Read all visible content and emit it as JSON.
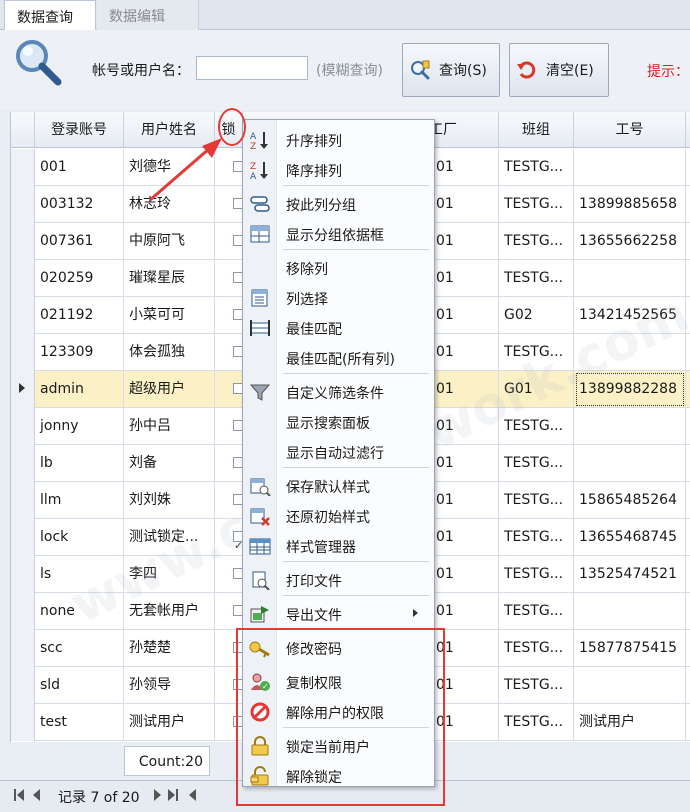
{
  "tabs": [
    {
      "label": "数据查询"
    },
    {
      "label": "数据编辑"
    }
  ],
  "toolbar": {
    "search_label": "帐号或用户名：",
    "search_value": "",
    "fuzzy_label": "(模糊查询)",
    "query_button": "查询(S)",
    "clear_button": "清空(E)",
    "hint_label": "提示："
  },
  "grid": {
    "columns": [
      "登录账号",
      "用户姓名",
      "锁",
      "工厂",
      "班组",
      "工号"
    ],
    "rows": [
      {
        "account": "001",
        "name": "刘德华",
        "locked": false,
        "factory": "01",
        "team": "TESTG...",
        "job_no": ""
      },
      {
        "account": "003132",
        "name": "林志玲",
        "locked": false,
        "factory": "01",
        "team": "TESTG...",
        "job_no": "13899885658"
      },
      {
        "account": "007361",
        "name": "中原阿飞",
        "locked": false,
        "factory": "01",
        "team": "TESTG...",
        "job_no": "13655662258"
      },
      {
        "account": "020259",
        "name": "璀璨星辰",
        "locked": false,
        "factory": "01",
        "team": "TESTG...",
        "job_no": ""
      },
      {
        "account": "021192",
        "name": "小菜可可",
        "locked": false,
        "factory": "01",
        "team": "G02",
        "job_no": "13421452565"
      },
      {
        "account": "123309",
        "name": "体会孤独",
        "locked": false,
        "factory": "01",
        "team": "TESTG...",
        "job_no": ""
      },
      {
        "account": "admin",
        "name": "超级用户",
        "locked": false,
        "factory": "01",
        "team": "G01",
        "job_no": "13899882288"
      },
      {
        "account": "jonny",
        "name": "孙中吕",
        "locked": false,
        "factory": "01",
        "team": "TESTG...",
        "job_no": ""
      },
      {
        "account": "lb",
        "name": "刘备",
        "locked": false,
        "factory": "01",
        "team": "TESTG...",
        "job_no": ""
      },
      {
        "account": "llm",
        "name": "刘刘姝",
        "locked": false,
        "factory": "01",
        "team": "TESTG...",
        "job_no": "15865485264"
      },
      {
        "account": "lock",
        "name": "测试锁定...",
        "locked": true,
        "factory": "01",
        "team": "TESTG...",
        "job_no": "13655468745"
      },
      {
        "account": "ls",
        "name": "李四",
        "locked": false,
        "factory": "01",
        "team": "TESTG...",
        "job_no": "13525474521"
      },
      {
        "account": "none",
        "name": "无套帐用户",
        "locked": false,
        "factory": "01",
        "team": "TESTG...",
        "job_no": ""
      },
      {
        "account": "scc",
        "name": "孙楚楚",
        "locked": false,
        "factory": "01",
        "team": "TESTG...",
        "job_no": "15877875415"
      },
      {
        "account": "sld",
        "name": "孙领导",
        "locked": false,
        "factory": "01",
        "team": "TESTG...",
        "job_no": ""
      },
      {
        "account": "test",
        "name": "测试用户",
        "locked": false,
        "factory": "01",
        "team": "TESTG...",
        "job_no": "测试用户"
      }
    ],
    "selected_row": 6
  },
  "footer": {
    "count": "Count:20",
    "record_text": "记录 7 of 20"
  },
  "menu": {
    "items": [
      {
        "label": "升序排列",
        "icon": "sort-ascending-icon"
      },
      {
        "label": "降序排列",
        "icon": "sort-descending-icon"
      },
      {
        "label": "按此列分组",
        "icon": "group-by-icon"
      },
      {
        "label": "显示分组依据框",
        "icon": "group-panel-icon"
      },
      {
        "label": "移除列",
        "icon": ""
      },
      {
        "label": "列选择",
        "icon": "column-chooser-icon"
      },
      {
        "label": "最佳匹配",
        "icon": "best-fit-icon"
      },
      {
        "label": "最佳匹配(所有列)",
        "icon": ""
      },
      {
        "label": "自定义筛选条件",
        "icon": "filter-icon"
      },
      {
        "label": "显示搜索面板",
        "icon": ""
      },
      {
        "label": "显示自动过滤行",
        "icon": ""
      },
      {
        "label": "保存默认样式",
        "icon": "save-layout-icon"
      },
      {
        "label": "还原初始样式",
        "icon": "restore-layout-icon"
      },
      {
        "label": "样式管理器",
        "icon": "style-manager-icon"
      },
      {
        "label": "打印文件",
        "icon": "print-icon"
      },
      {
        "label": "导出文件",
        "icon": "export-icon"
      },
      {
        "label": "修改密码",
        "icon": "key-icon"
      },
      {
        "label": "复制权限",
        "icon": "copy-permission-icon"
      },
      {
        "label": "解除用户的权限",
        "icon": "remove-permission-icon"
      },
      {
        "label": "锁定当前用户",
        "icon": "lock-icon"
      },
      {
        "label": "解除锁定",
        "icon": "unlock-icon"
      }
    ]
  },
  "colors": {
    "annotation_red": "#e53935",
    "selected_row": "#fcf1c6",
    "hint_red": "#d21f1f"
  }
}
